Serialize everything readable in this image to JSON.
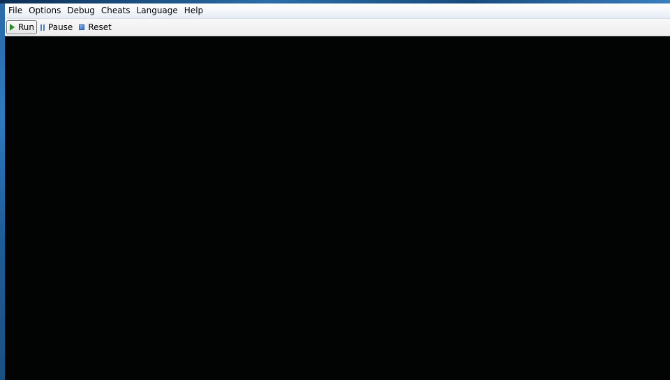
{
  "menubar": {
    "items": [
      "File",
      "Options",
      "Debug",
      "Cheats",
      "Language",
      "Help"
    ]
  },
  "toolbar": {
    "run_label": "Run",
    "pause_label": "Pause",
    "reset_label": "Reset"
  },
  "icons": {
    "run": "play-icon",
    "pause": "pause-icon",
    "reset": "stop-icon"
  },
  "colors": {
    "screen_background": "#020403",
    "run_icon": "#2f8a2a",
    "pause_icon": "#4f7fbf",
    "reset_icon": "#3b6fc4"
  }
}
